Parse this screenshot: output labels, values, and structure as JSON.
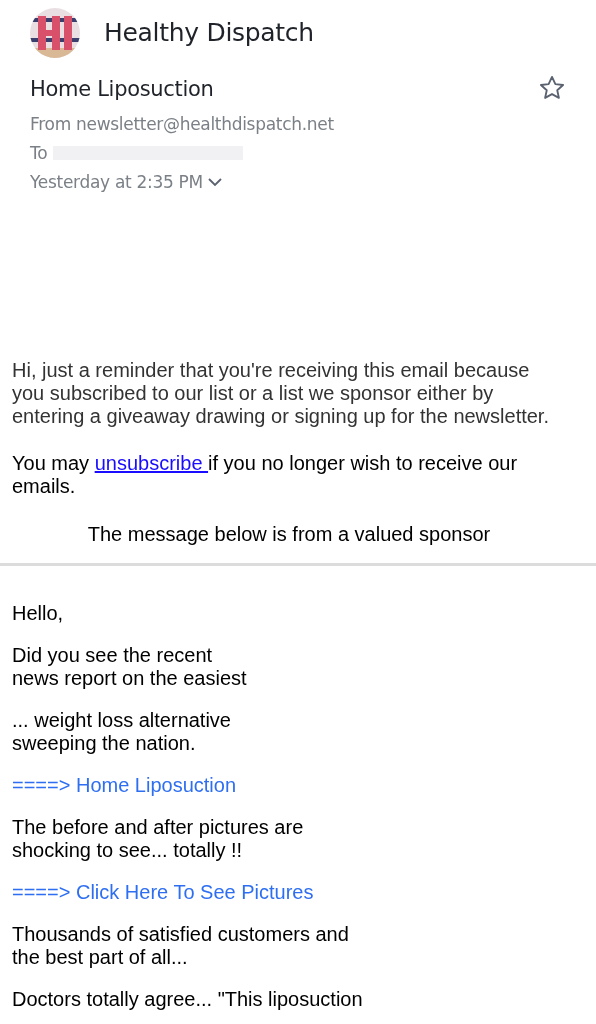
{
  "sender": {
    "name": "Healthy Dispatch"
  },
  "message": {
    "subject": "Home Liposuction",
    "starred": false,
    "from": "From newsletter@healthdispatch.net",
    "to_label": "To",
    "date": "Yesterday at 2:35 PM"
  },
  "notice": {
    "intro": "Hi, just a reminder that you're receiving this email because you subscribed to our list or a list we sponsor either by entering a giveaway drawing or signing up for the newsletter.",
    "unsub_before": "You may ",
    "unsub_link": "unsubscribe ",
    "unsub_after": "if you no longer wish to receive our emails.",
    "sponsor_note": "The message below is from a valued sponsor"
  },
  "body": [
    {
      "kind": "text",
      "text": "Hello,"
    },
    {
      "kind": "text",
      "text": "Did you see the recent\nnews report on the easiest"
    },
    {
      "kind": "text",
      "text": "... weight loss alternative\nsweeping the nation."
    },
    {
      "kind": "link",
      "text": "====> Home Liposuction"
    },
    {
      "kind": "text",
      "text": "The before and after pictures are\nshocking to see... totally !!"
    },
    {
      "kind": "link",
      "text": "====> Click Here To See Pictures"
    },
    {
      "kind": "text",
      "text": "Thousands of satisfied customers and\nthe best part of all..."
    },
    {
      "kind": "text",
      "text": "Doctors totally agree... \"This liposuction"
    }
  ]
}
